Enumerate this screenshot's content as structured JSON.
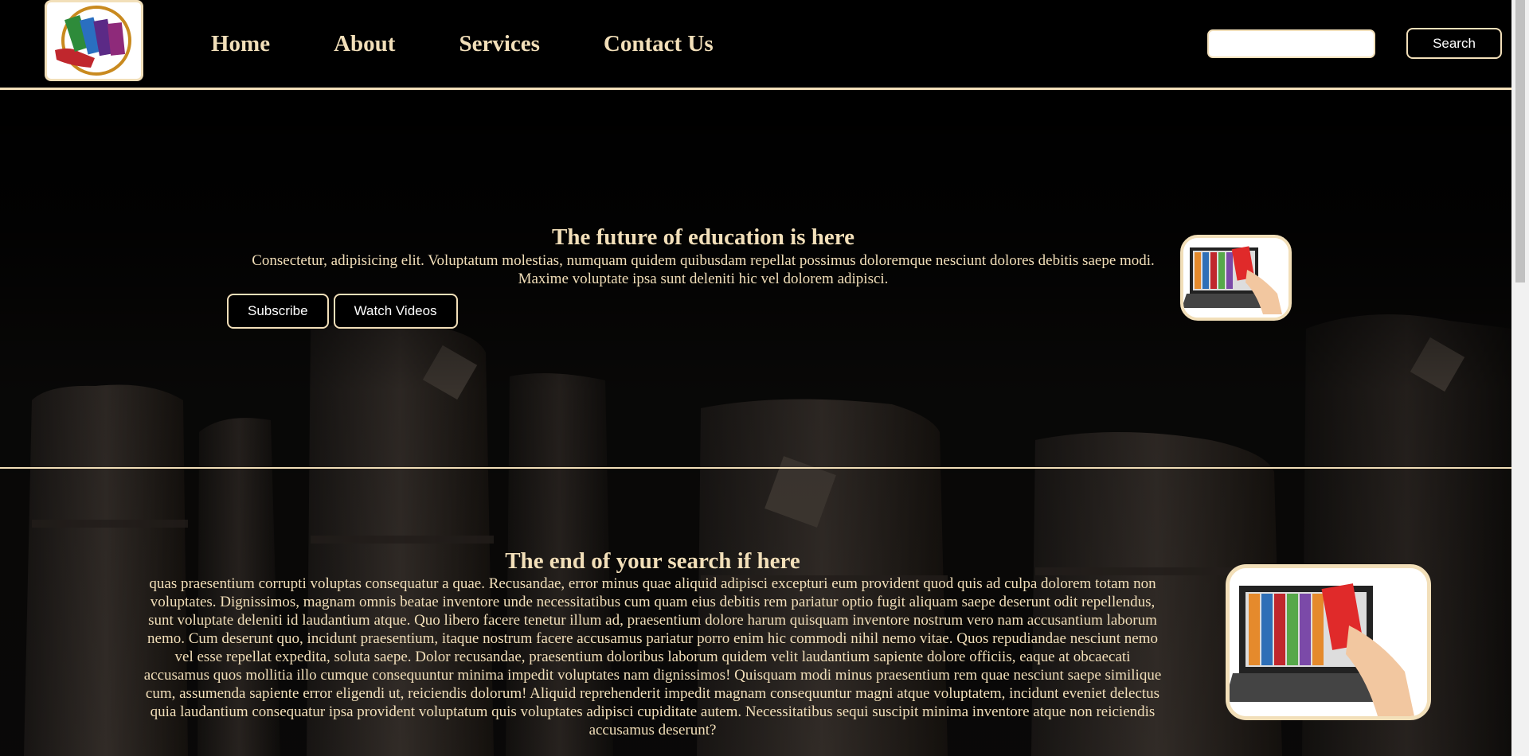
{
  "nav": {
    "links": [
      {
        "label": "Home"
      },
      {
        "label": "About"
      },
      {
        "label": "Services"
      },
      {
        "label": "Contact Us"
      }
    ],
    "search_placeholder": "",
    "search_button": "Search"
  },
  "hero": {
    "title": "The future of education is here",
    "paragraph": "Consectetur, adipisicing elit. Voluptatum molestias, numquam quidem quibusdam repellat possimus doloremque nesciunt dolores debitis saepe modi. Maxime voluptate ipsa sunt deleniti hic vel dolorem adipisci.",
    "subscribe_label": "Subscribe",
    "watch_label": "Watch Videos"
  },
  "about": {
    "title": "The end of your search if here",
    "paragraph": "quas praesentium corrupti voluptas consequatur a quae. Recusandae, error minus quae aliquid adipisci excepturi eum provident quod quis ad culpa dolorem totam non voluptates. Dignissimos, magnam omnis beatae inventore unde necessitatibus cum quam eius debitis rem pariatur optio fugit aliquam saepe deserunt odit repellendus, sunt voluptate deleniti id laudantium atque. Quo libero facere tenetur illum ad, praesentium dolore harum quisquam inventore nostrum vero nam accusantium laborum nemo. Cum deserunt quo, incidunt praesentium, itaque nostrum facere accusamus pariatur porro enim hic commodi nihil nemo vitae. Quos repudiandae nesciunt nemo vel esse repellat expedita, soluta saepe. Dolor recusandae, praesentium doloribus laborum quidem velit laudantium sapiente dolore officiis, eaque at obcaecati accusamus quos mollitia illo cumque consequuntur minima impedit voluptates nam dignissimos! Quisquam modi minus praesentium rem quae nesciunt saepe similique cum, assumenda sapiente error eligendi ut, reiciendis dolorum! Aliquid reprehenderit impedit magnam consequuntur magni atque voluptatem, incidunt eveniet delectus quia laudantium consequatur ipsa provident voluptatum quis voluptates adipisci cupiditate autem. Necessitatibus sequi suscipit minima inventore atque non reiciendis accusamus deserunt?"
  },
  "icons": {
    "logo": "books-hand-logo-icon",
    "hero_image": "laptop-books-icon",
    "about_image": "laptop-books-icon"
  },
  "colors": {
    "accent": "#f2dfb9",
    "background": "#000000",
    "button_text": "#ffffff"
  }
}
